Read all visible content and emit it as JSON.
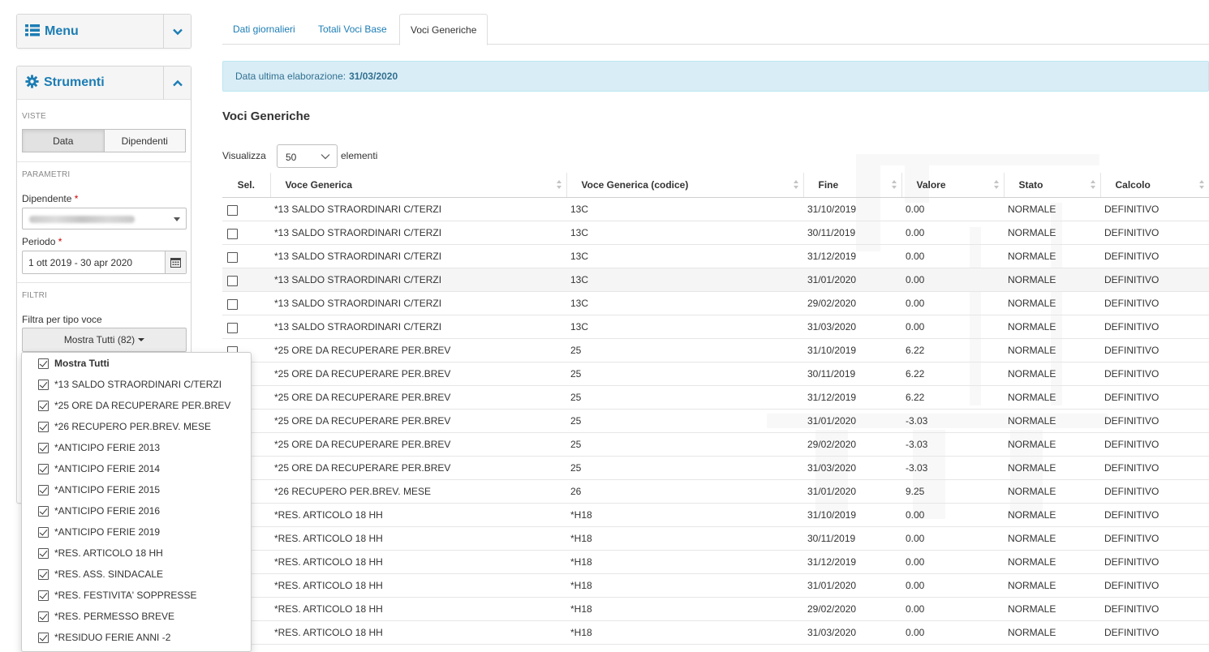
{
  "sidebar": {
    "menu_title": "Menu",
    "tools_title": "Strumenti",
    "views_label": "VISTE",
    "view_buttons": [
      "Data",
      "Dipendenti"
    ],
    "params_label": "PARAMETRI",
    "employee_label": "Dipendente",
    "required_mark": "*",
    "period_label": "Periodo",
    "period_value": "1 ott 2019 - 30 apr 2020",
    "filters_label": "FILTRI",
    "filter_type_label": "Filtra per tipo voce",
    "filter_button_label": "Mostra Tutti (82)",
    "filter_options": [
      "Mostra Tutti",
      "*13 SALDO STRAORDINARI C/TERZI",
      "*25 ORE DA RECUPERARE PER.BREV",
      "*26 RECUPERO PER.BREV. MESE",
      "*ANTICIPO FERIE 2013",
      "*ANTICIPO FERIE 2014",
      "*ANTICIPO FERIE 2015",
      "*ANTICIPO FERIE 2016",
      "*ANTICIPO FERIE 2019",
      "*RES. ARTICOLO 18 HH",
      "*RES. ASS. SINDACALE",
      "*RES. FESTIVITA' SOPPRESSE",
      "*RES. PERMESSO BREVE",
      "*RESIDUO FERIE ANNI -2"
    ]
  },
  "tabs": [
    "Dati giornalieri",
    "Totali Voci Base",
    "Voci Generiche"
  ],
  "alert": {
    "label": "Data ultima elaborazione:",
    "value": "31/03/2020"
  },
  "page_title": "Voci Generiche",
  "length": {
    "prefix": "Visualizza",
    "value": "50",
    "suffix": "elementi"
  },
  "table": {
    "columns": [
      "Sel.",
      "Voce Generica",
      "Voce Generica (codice)",
      "Fine",
      "Valore",
      "Stato",
      "Calcolo"
    ],
    "rows": [
      [
        "*13 SALDO STRAORDINARI C/TERZI",
        "13C",
        "31/10/2019",
        "0.00",
        "NORMALE",
        "DEFINITIVO"
      ],
      [
        "*13 SALDO STRAORDINARI C/TERZI",
        "13C",
        "30/11/2019",
        "0.00",
        "NORMALE",
        "DEFINITIVO"
      ],
      [
        "*13 SALDO STRAORDINARI C/TERZI",
        "13C",
        "31/12/2019",
        "0.00",
        "NORMALE",
        "DEFINITIVO"
      ],
      [
        "*13 SALDO STRAORDINARI C/TERZI",
        "13C",
        "31/01/2020",
        "0.00",
        "NORMALE",
        "DEFINITIVO"
      ],
      [
        "*13 SALDO STRAORDINARI C/TERZI",
        "13C",
        "29/02/2020",
        "0.00",
        "NORMALE",
        "DEFINITIVO"
      ],
      [
        "*13 SALDO STRAORDINARI C/TERZI",
        "13C",
        "31/03/2020",
        "0.00",
        "NORMALE",
        "DEFINITIVO"
      ],
      [
        "*25 ORE DA RECUPERARE PER.BREV",
        "25",
        "31/10/2019",
        "6.22",
        "NORMALE",
        "DEFINITIVO"
      ],
      [
        "*25 ORE DA RECUPERARE PER.BREV",
        "25",
        "30/11/2019",
        "6.22",
        "NORMALE",
        "DEFINITIVO"
      ],
      [
        "*25 ORE DA RECUPERARE PER.BREV",
        "25",
        "31/12/2019",
        "6.22",
        "NORMALE",
        "DEFINITIVO"
      ],
      [
        "*25 ORE DA RECUPERARE PER.BREV",
        "25",
        "31/01/2020",
        "-3.03",
        "NORMALE",
        "DEFINITIVO"
      ],
      [
        "*25 ORE DA RECUPERARE PER.BREV",
        "25",
        "29/02/2020",
        "-3.03",
        "NORMALE",
        "DEFINITIVO"
      ],
      [
        "*25 ORE DA RECUPERARE PER.BREV",
        "25",
        "31/03/2020",
        "-3.03",
        "NORMALE",
        "DEFINITIVO"
      ],
      [
        "*26 RECUPERO PER.BREV. MESE",
        "26",
        "31/01/2020",
        "9.25",
        "NORMALE",
        "DEFINITIVO"
      ],
      [
        "*RES. ARTICOLO 18 HH",
        "*H18",
        "31/10/2019",
        "0.00",
        "NORMALE",
        "DEFINITIVO"
      ],
      [
        "*RES. ARTICOLO 18 HH",
        "*H18",
        "30/11/2019",
        "0.00",
        "NORMALE",
        "DEFINITIVO"
      ],
      [
        "*RES. ARTICOLO 18 HH",
        "*H18",
        "31/12/2019",
        "0.00",
        "NORMALE",
        "DEFINITIVO"
      ],
      [
        "*RES. ARTICOLO 18 HH",
        "*H18",
        "31/01/2020",
        "0.00",
        "NORMALE",
        "DEFINITIVO"
      ],
      [
        "*RES. ARTICOLO 18 HH",
        "*H18",
        "29/02/2020",
        "0.00",
        "NORMALE",
        "DEFINITIVO"
      ],
      [
        "*RES. ARTICOLO 18 HH",
        "*H18",
        "31/03/2020",
        "0.00",
        "NORMALE",
        "DEFINITIVO"
      ]
    ]
  },
  "colors": {
    "accent": "#1c7db4",
    "alert_bg": "#d9edf7",
    "alert_text": "#31708f",
    "required": "#cc0000"
  },
  "icons": {
    "menu": "list-icon",
    "tools": "gear-icon",
    "collapse_down": "chevron-down-icon",
    "collapse_up": "chevron-up-icon",
    "calendar": "calendar-icon"
  }
}
